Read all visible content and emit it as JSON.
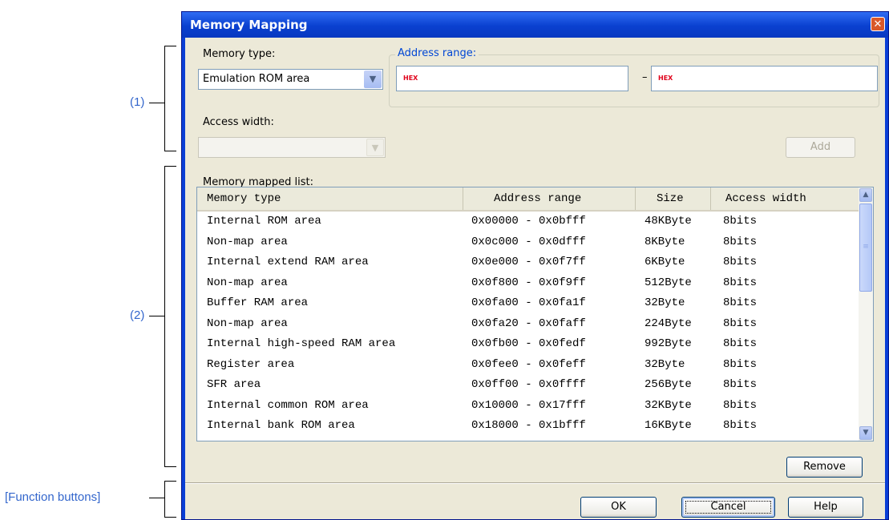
{
  "annotations": {
    "section1": "(1)",
    "section2": "(2)",
    "function_buttons": "[Function buttons]"
  },
  "dialog": {
    "title": "Memory Mapping",
    "close_glyph": "✕"
  },
  "form": {
    "memory_type_label": "Memory type:",
    "memory_type_value": "Emulation ROM area",
    "address_range_label": "Address range:",
    "address_start_placeholder": "HEX",
    "address_separator": "–",
    "address_end_placeholder": "HEX",
    "access_width_label": "Access width:",
    "access_width_value": "",
    "add_label": "Add"
  },
  "list": {
    "label": "Memory mapped list:",
    "columns": [
      "Memory type",
      "Address range",
      "Size",
      "Access width"
    ],
    "rows": [
      [
        "Internal ROM area",
        "0x00000 - 0x0bfff",
        "48KByte",
        "8bits"
      ],
      [
        "Non-map area",
        "0x0c000 - 0x0dfff",
        "8KByte",
        "8bits"
      ],
      [
        "Internal extend RAM area",
        "0x0e000 - 0x0f7ff",
        "6KByte",
        "8bits"
      ],
      [
        "Non-map area",
        "0x0f800 - 0x0f9ff",
        "512Byte",
        "8bits"
      ],
      [
        "Buffer RAM area",
        "0x0fa00 - 0x0fa1f",
        "32Byte",
        "8bits"
      ],
      [
        "Non-map area",
        "0x0fa20 - 0x0faff",
        "224Byte",
        "8bits"
      ],
      [
        "Internal high-speed RAM area",
        "0x0fb00 - 0x0fedf",
        "992Byte",
        "8bits"
      ],
      [
        "Register area",
        "0x0fee0 - 0x0feff",
        "32Byte",
        "8bits"
      ],
      [
        "SFR area",
        "0x0ff00 - 0x0ffff",
        "256Byte",
        "8bits"
      ],
      [
        "Internal common ROM area",
        "0x10000 - 0x17fff",
        "32KByte",
        "8bits"
      ],
      [
        "Internal bank ROM area",
        "0x18000 - 0x1bfff",
        "16KByte",
        "8bits"
      ]
    ],
    "remove_label": "Remove"
  },
  "footer": {
    "ok_label": "OK",
    "cancel_label": "Cancel",
    "help_label": "Help"
  }
}
